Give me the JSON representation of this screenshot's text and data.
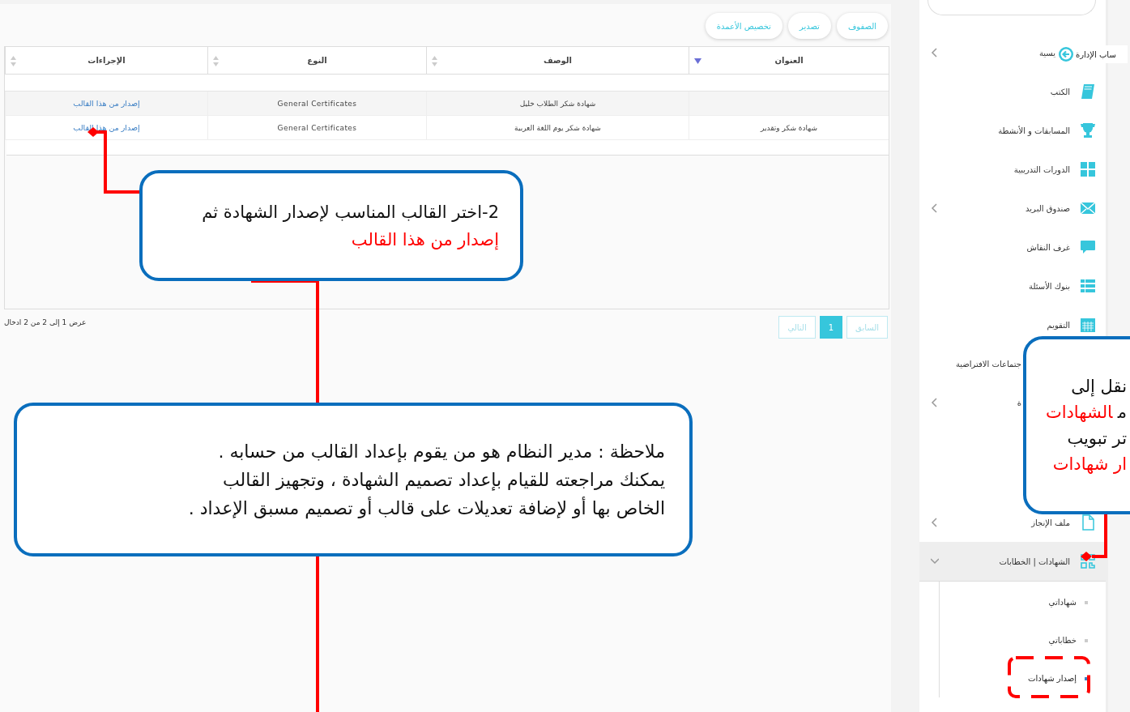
{
  "toolbar": {
    "buttons": [
      "الصفوف",
      "تصدير",
      "تخصيص الأعمدة"
    ]
  },
  "table": {
    "columns": [
      {
        "label": "العنوان",
        "sorted": true
      },
      {
        "label": "الوصف",
        "sorted": false
      },
      {
        "label": "النوع",
        "sorted": false
      },
      {
        "label": "الإجراءات",
        "sorted": false
      }
    ],
    "rows": [
      {
        "description": "شهادة شكر الطلاب خليل",
        "type": "General Certificates",
        "action": "إصدار من هذا القالب"
      },
      {
        "title": "شهادة شكر وتقدير",
        "description": "شهادة شكر يوم اللغة العربية",
        "type": "General Certificates",
        "action": "إصدار من هذا القالب"
      }
    ]
  },
  "pagination": {
    "info": "عرض 1 إلى 2 من 2 ادخال",
    "pages": [
      {
        "label": "السابق",
        "selected": false,
        "disabled": true
      },
      {
        "label": "1",
        "selected": true,
        "disabled": false
      },
      {
        "label": "التالي",
        "selected": false,
        "disabled": true
      }
    ]
  },
  "sidebar": {
    "tooltip": "ساب الإدارة",
    "items": [
      {
        "label": "يسية",
        "has_submenu": true
      },
      {
        "label": "الكتب",
        "has_submenu": false
      },
      {
        "label": "المسابقات و الأنشطة",
        "has_submenu": false
      },
      {
        "label": "الدورات التدريبية",
        "has_submenu": false
      },
      {
        "label": "صندوق البريد",
        "has_submenu": true
      },
      {
        "label": "غرف النقاش",
        "has_submenu": false
      },
      {
        "label": "بنوك الأسئلة",
        "has_submenu": false
      },
      {
        "label": "التقويم",
        "has_submenu": false
      },
      {
        "label": "جتماعات الافتراضية",
        "has_submenu": false
      },
      {
        "label": "ة",
        "has_submenu": true
      },
      {
        "label": "ملف الإنجاز",
        "has_submenu": true
      },
      {
        "label": "الشهادات | الخطابات",
        "has_submenu": true,
        "expanded": true,
        "children": [
          {
            "label": "شهاداتي",
            "selected": false
          },
          {
            "label": "خطاباتي",
            "selected": false
          },
          {
            "label": "إصدار شهادات",
            "selected": true
          }
        ]
      }
    ]
  },
  "callouts": [
    {
      "lines": [
        [
          {
            "text": "2-اختر القالب المناسب لإصدار الشهادة ثم",
            "highlight": false
          }
        ],
        [
          {
            "text": "إصدار من هذا القالب",
            "highlight": true
          }
        ]
      ]
    },
    {
      "lines": [
        [
          {
            "text": "ملاحظة : مدير النظام هو من يقوم بإعداد القالب من حسابه .",
            "highlight": false
          }
        ],
        [
          {
            "text": "يمكنك مراجعته للقيام بإعداد تصميم الشهادة ، وتجهيز القالب",
            "highlight": false
          }
        ],
        [
          {
            "text": "الخاص بها أو لإضافة تعديلات على قالب أو تصميم مسبق الإعداد .",
            "highlight": false
          }
        ]
      ]
    },
    {
      "lines": [
        [
          {
            "text": "نقل إلى",
            "highlight": false
          }
        ],
        [
          {
            "text": "م",
            "highlight": false
          },
          {
            "text": "الشهادات",
            "highlight": true
          }
        ],
        [
          {
            "text": "تر تبويب",
            "highlight": false
          }
        ],
        [
          {
            "text": "ار شهادات",
            "highlight": true
          }
        ]
      ]
    }
  ]
}
